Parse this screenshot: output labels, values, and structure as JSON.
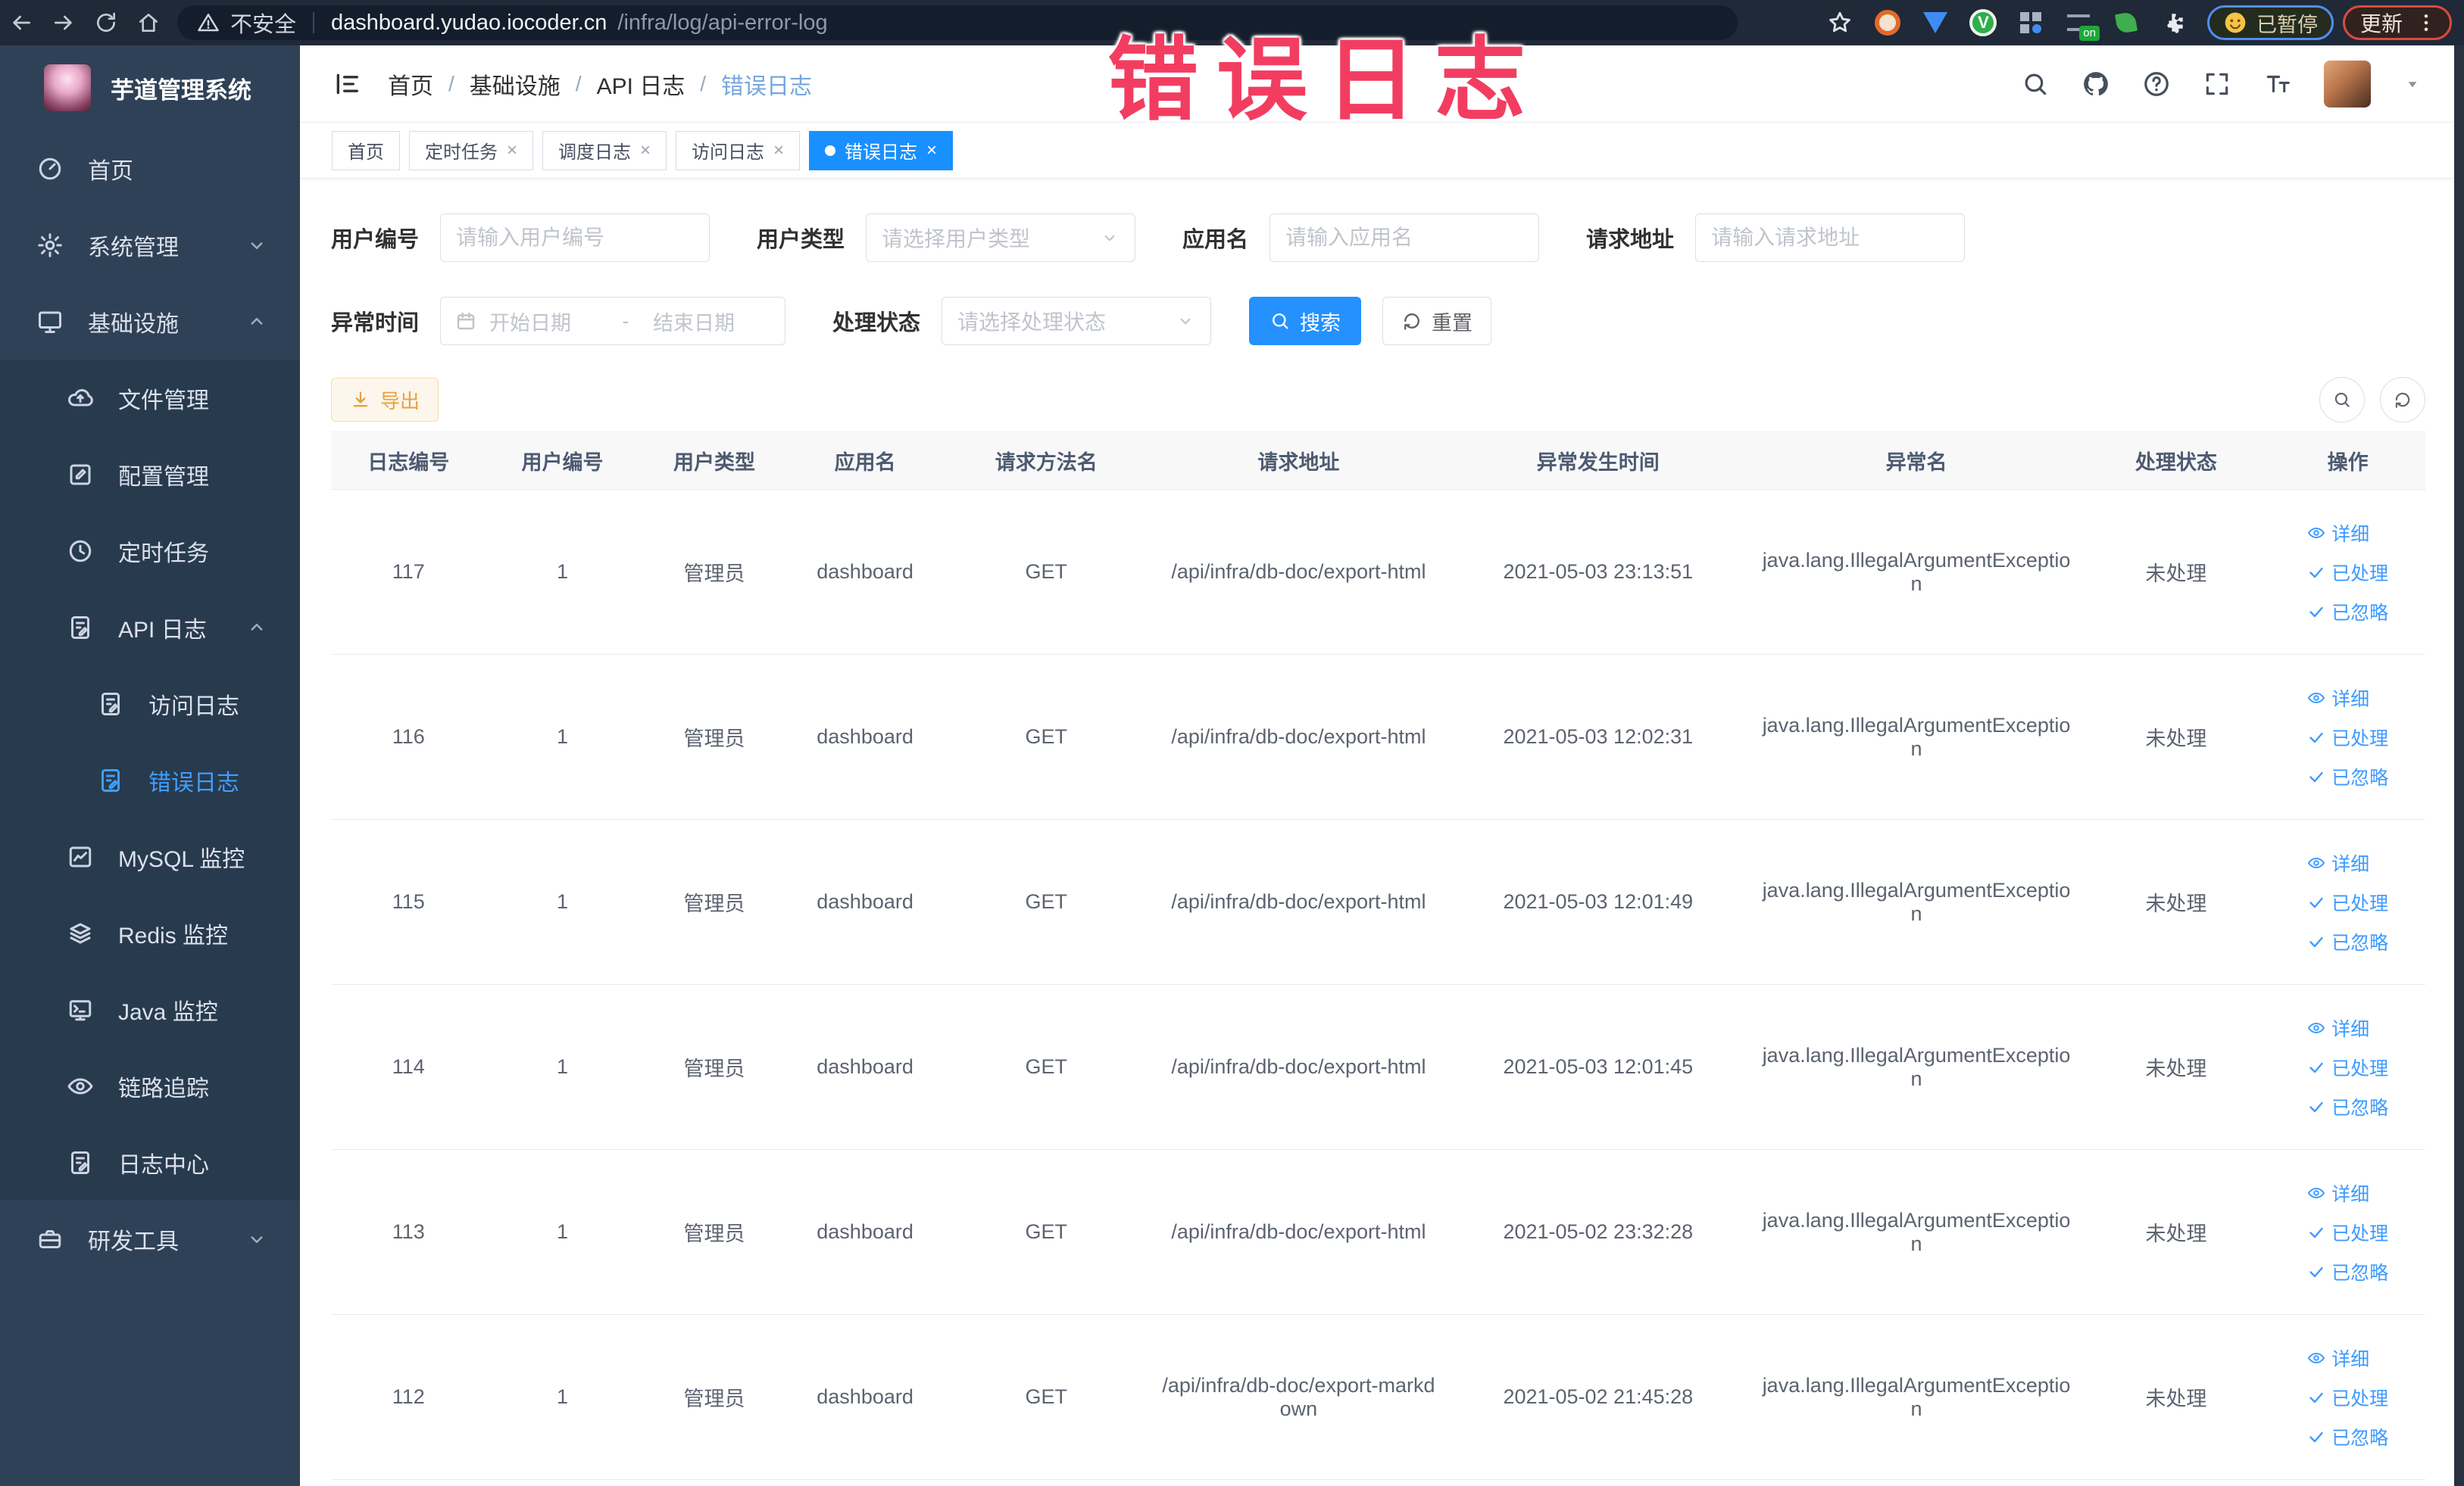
{
  "annotation": {
    "text": "错误日志",
    "color": "#f23d61"
  },
  "browser": {
    "security_label": "不安全",
    "url_host": "dashboard.yudao.iocoder.cn",
    "url_path": "/infra/log/api-error-log",
    "ext_on_badge": "on",
    "paused_badge_label": "已暂停",
    "update_button_label": "更新"
  },
  "sidebar": {
    "app_title": "芋道管理系统",
    "items": [
      {
        "label": "首页"
      },
      {
        "label": "系统管理"
      },
      {
        "label": "基础设施"
      },
      {
        "label": "文件管理"
      },
      {
        "label": "配置管理"
      },
      {
        "label": "定时任务"
      },
      {
        "label": "API 日志"
      },
      {
        "label": "访问日志"
      },
      {
        "label": "错误日志"
      },
      {
        "label": "MySQL 监控"
      },
      {
        "label": "Redis 监控"
      },
      {
        "label": "Java 监控"
      },
      {
        "label": "链路追踪"
      },
      {
        "label": "日志中心"
      },
      {
        "label": "研发工具"
      }
    ]
  },
  "navbar": {
    "breadcrumb": [
      "首页",
      "基础设施",
      "API 日志",
      "错误日志"
    ]
  },
  "tabs": [
    {
      "label": "首页"
    },
    {
      "label": "定时任务"
    },
    {
      "label": "调度日志"
    },
    {
      "label": "访问日志"
    },
    {
      "label": "错误日志"
    }
  ],
  "filters": {
    "user_id_label": "用户编号",
    "user_id_placeholder": "请输入用户编号",
    "user_type_label": "用户类型",
    "user_type_placeholder": "请选择用户类型",
    "app_name_label": "应用名",
    "app_name_placeholder": "请输入应用名",
    "request_url_label": "请求地址",
    "request_url_placeholder": "请输入请求地址",
    "exception_time_label": "异常时间",
    "date_start_placeholder": "开始日期",
    "date_separator": "-",
    "date_end_placeholder": "结束日期",
    "process_status_label": "处理状态",
    "process_status_placeholder": "请选择处理状态",
    "search_label": "搜索",
    "reset_label": "重置"
  },
  "toolbar": {
    "export_label": "导出"
  },
  "table": {
    "headers": [
      "日志编号",
      "用户编号",
      "用户类型",
      "应用名",
      "请求方法名",
      "请求地址",
      "异常发生时间",
      "异常名",
      "处理状态",
      "操作"
    ],
    "action_labels": {
      "detail": "详细",
      "processed": "已处理",
      "ignored": "已忽略"
    },
    "rows": [
      {
        "log_id": "117",
        "user_id": "1",
        "user_type": "管理员",
        "app_name": "dashboard",
        "method": "GET",
        "url": "/api/infra/db-doc/export-html",
        "time": "2021-05-03 23:13:51",
        "exception": "java.lang.IllegalArgumentException",
        "status": "未处理"
      },
      {
        "log_id": "116",
        "user_id": "1",
        "user_type": "管理员",
        "app_name": "dashboard",
        "method": "GET",
        "url": "/api/infra/db-doc/export-html",
        "time": "2021-05-03 12:02:31",
        "exception": "java.lang.IllegalArgumentException",
        "status": "未处理"
      },
      {
        "log_id": "115",
        "user_id": "1",
        "user_type": "管理员",
        "app_name": "dashboard",
        "method": "GET",
        "url": "/api/infra/db-doc/export-html",
        "time": "2021-05-03 12:01:49",
        "exception": "java.lang.IllegalArgumentException",
        "status": "未处理"
      },
      {
        "log_id": "114",
        "user_id": "1",
        "user_type": "管理员",
        "app_name": "dashboard",
        "method": "GET",
        "url": "/api/infra/db-doc/export-html",
        "time": "2021-05-03 12:01:45",
        "exception": "java.lang.IllegalArgumentException",
        "status": "未处理"
      },
      {
        "log_id": "113",
        "user_id": "1",
        "user_type": "管理员",
        "app_name": "dashboard",
        "method": "GET",
        "url": "/api/infra/db-doc/export-html",
        "time": "2021-05-02 23:32:28",
        "exception": "java.lang.IllegalArgumentException",
        "status": "未处理"
      },
      {
        "log_id": "112",
        "user_id": "1",
        "user_type": "管理员",
        "app_name": "dashboard",
        "method": "GET",
        "url": "/api/infra/db-doc/export-markdown",
        "time": "2021-05-02 21:45:28",
        "exception": "java.lang.IllegalArgumentException",
        "status": "未处理"
      }
    ]
  },
  "colors": {
    "primary": "#2491ff",
    "link": "#409eff",
    "active_tab": "#1890ff",
    "warning": "#e6a23c",
    "sidebar_bg": "#2f4156"
  }
}
